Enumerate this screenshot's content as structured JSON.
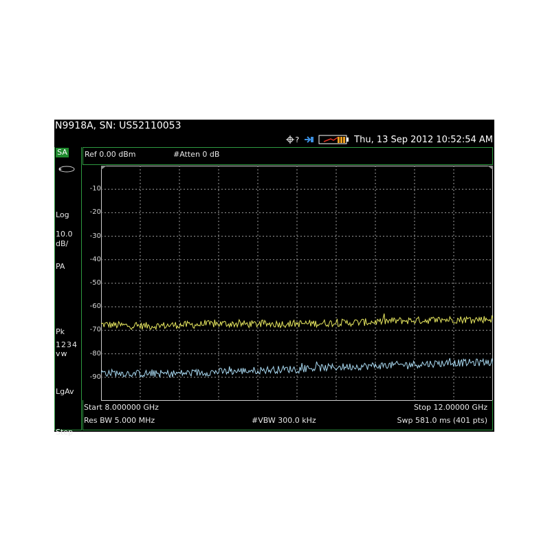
{
  "window": {
    "title": "N9918A, SN: US52110053",
    "datetime": "Thu, 13 Sep 2012 10:52:54 AM"
  },
  "status_icons": [
    "gps-satellite-icon",
    "usb-connection-icon",
    "battery-icon"
  ],
  "status_icon_suffix": "?",
  "left_panel": {
    "mode": "SA",
    "scale_type": "Log",
    "scale_value": "10.0",
    "scale_unit": "dB/",
    "preamp": "PA",
    "detector": "Pk",
    "traces": "1234",
    "trace_modes": "vw",
    "average_type": "LgAv",
    "step": "Step"
  },
  "ref_bar": {
    "ref_level": "Ref 0.00 dBm",
    "attenuation": "#Atten 0 dB"
  },
  "footer": {
    "start": "Start 8.000000 GHz",
    "stop": "Stop 12.00000 GHz",
    "res_bw": "Res BW 5.000 MHz",
    "vbw": "#VBW 300.0 kHz",
    "sweep": "Swp 581.0 ms (401 pts)"
  },
  "colors": {
    "background": "#000000",
    "grid": "#a0a0a0",
    "frame": "#2e9a40",
    "trace_yellow": "#e8e860",
    "trace_blue": "#a8d8f0",
    "mode_badge": "#1f8a2e"
  },
  "chart_data": {
    "type": "line",
    "x_label_start": "Start 8.000000 GHz",
    "x_label_stop": "Stop 12.00000 GHz",
    "xlim": [
      8.0,
      12.0
    ],
    "ylim": [
      -100,
      0
    ],
    "y_ticks": [
      -10,
      -20,
      -30,
      -40,
      -50,
      -60,
      -70,
      -80,
      -90
    ],
    "grid": true,
    "series": [
      {
        "color": "#e8e860",
        "x": [
          8.0,
          8.25,
          8.5,
          8.75,
          9.0,
          9.25,
          9.5,
          9.75,
          10.0,
          10.25,
          10.5,
          10.75,
          11.0,
          11.25,
          11.5,
          11.75,
          12.0
        ],
        "y": [
          -67.5,
          -68.0,
          -68.2,
          -67.8,
          -67.6,
          -67.2,
          -67.4,
          -67.3,
          -67.2,
          -67.0,
          -66.8,
          -66.5,
          -66.0,
          -65.8,
          -65.5,
          -65.4,
          -65.2
        ]
      },
      {
        "color": "#a8d8f0",
        "x": [
          8.0,
          8.25,
          8.5,
          8.75,
          9.0,
          9.25,
          9.5,
          9.75,
          10.0,
          10.25,
          10.5,
          10.75,
          11.0,
          11.25,
          11.5,
          11.75,
          12.0
        ],
        "y": [
          -88.0,
          -88.3,
          -88.5,
          -88.4,
          -88.0,
          -87.6,
          -87.2,
          -86.8,
          -86.4,
          -86.0,
          -85.5,
          -85.2,
          -84.8,
          -84.4,
          -84.0,
          -83.8,
          -83.5
        ]
      }
    ]
  }
}
